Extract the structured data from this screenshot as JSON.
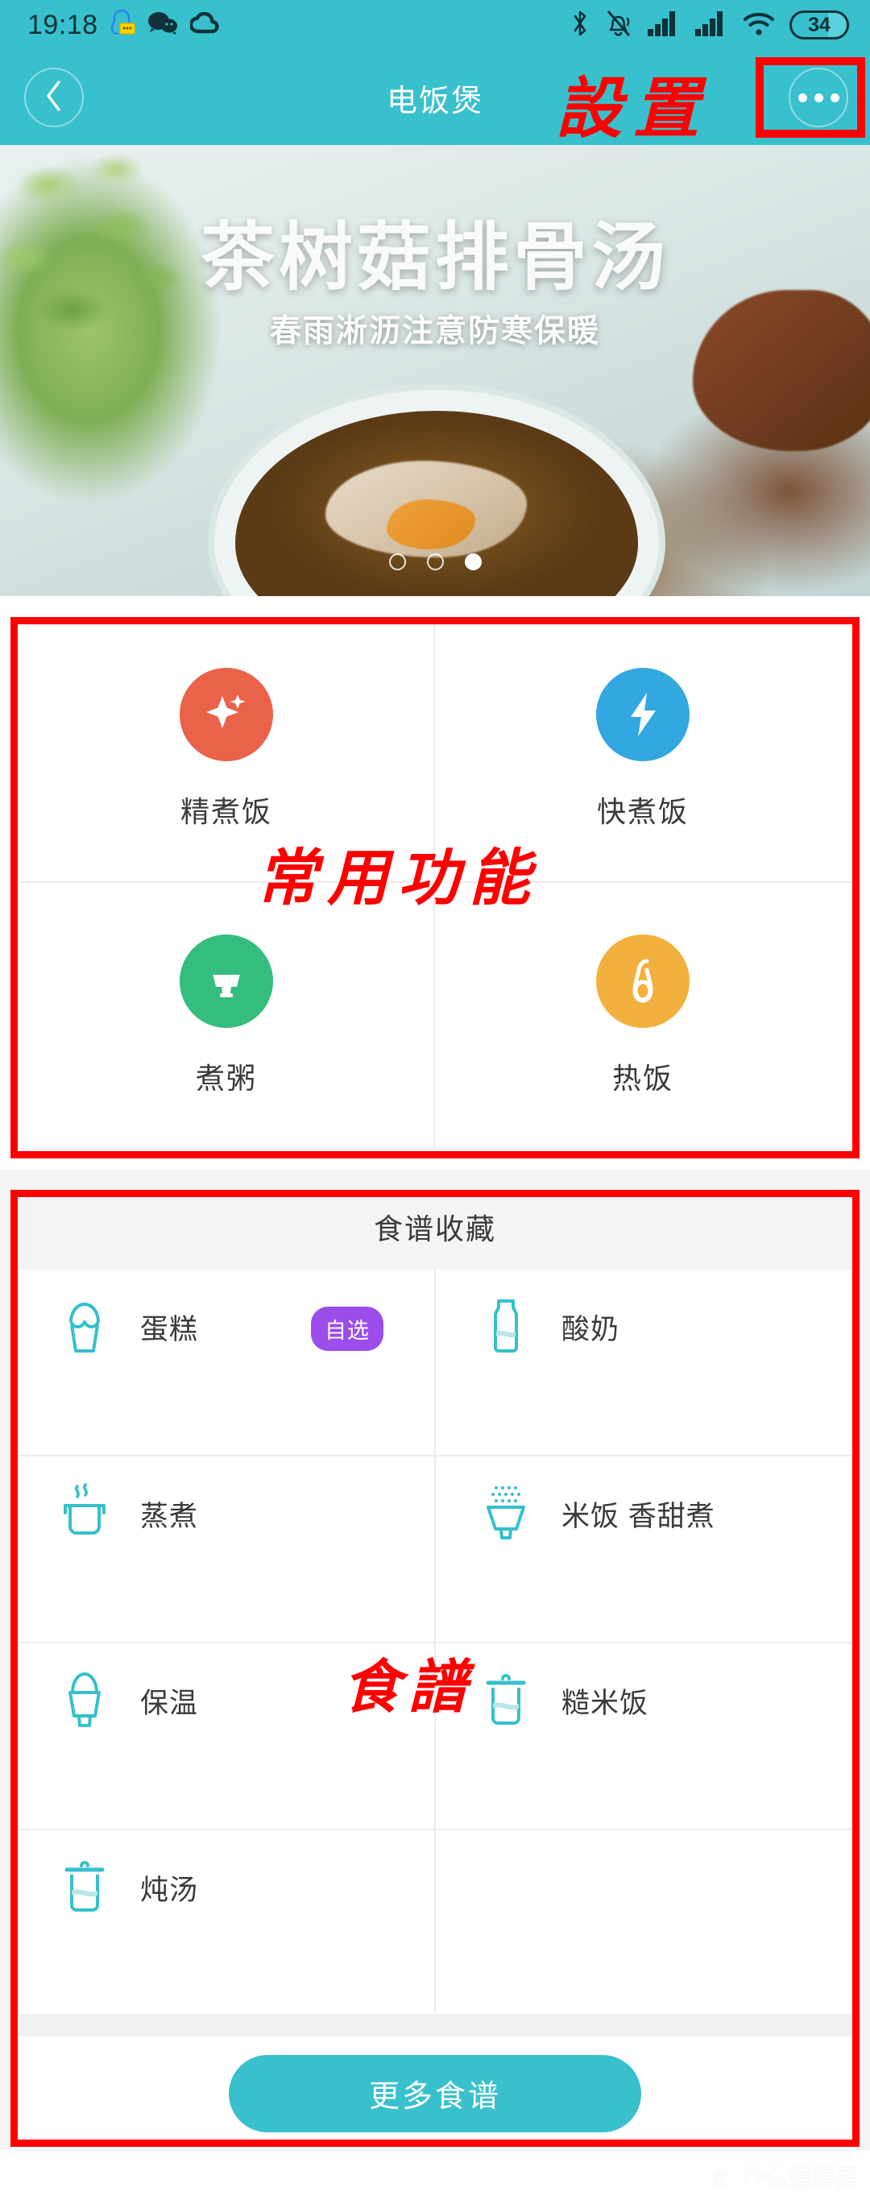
{
  "status_bar": {
    "time": "19:18",
    "battery_level": "34",
    "left_icons": [
      "qq-icon",
      "wechat-icon",
      "cloud-icon"
    ],
    "right_icons": [
      "bluetooth-icon",
      "bell-muted-icon",
      "signal-1-icon",
      "signal-2-icon",
      "wifi-icon",
      "battery-icon"
    ]
  },
  "header": {
    "title": "电饭煲",
    "back_icon": "chevron-left-icon",
    "more_icon": "ellipsis-icon"
  },
  "hero": {
    "title": "茶树菇排骨汤",
    "subtitle": "春雨淅沥注意防寒保暖",
    "dots_total": 3,
    "dots_active_index": 2
  },
  "functions": {
    "items": [
      {
        "label": "精煮饭",
        "icon": "sparkle-icon",
        "color": "#e8634a"
      },
      {
        "label": "快煮饭",
        "icon": "lightning-icon",
        "color": "#33a7e0"
      },
      {
        "label": "煮粥",
        "icon": "porridge-bowl-icon",
        "color": "#35bd7e"
      },
      {
        "label": "热饭",
        "icon": "ladle-icon",
        "color": "#f2b13f"
      }
    ]
  },
  "recipes": {
    "section_title": "食谱收藏",
    "accent_color": "#38c0cc",
    "badge_color": "#9b4dea",
    "items": [
      {
        "label": "蛋糕",
        "icon": "cupcake-icon",
        "badge": "自选"
      },
      {
        "label": "酸奶",
        "icon": "milk-bottle-icon",
        "badge": ""
      },
      {
        "label": "蒸煮",
        "icon": "steam-pot-icon",
        "badge": ""
      },
      {
        "label": "米饭 香甜煮",
        "icon": "rice-bowl-icon",
        "badge": ""
      },
      {
        "label": "保温",
        "icon": "keep-warm-icon",
        "badge": ""
      },
      {
        "label": "糙米饭",
        "icon": "lidded-pot-icon",
        "badge": ""
      },
      {
        "label": "炖汤",
        "icon": "stew-pot-icon",
        "badge": ""
      },
      {
        "label": "",
        "icon": "",
        "badge": ""
      }
    ],
    "more_button": "更多食谱"
  },
  "annotations": {
    "color": "#ff0000",
    "settings_label": "設置",
    "common_functions_label": "常用功能",
    "recipe_label": "食譜"
  },
  "watermark": {
    "mark": "值",
    "text": "什么值得买"
  }
}
